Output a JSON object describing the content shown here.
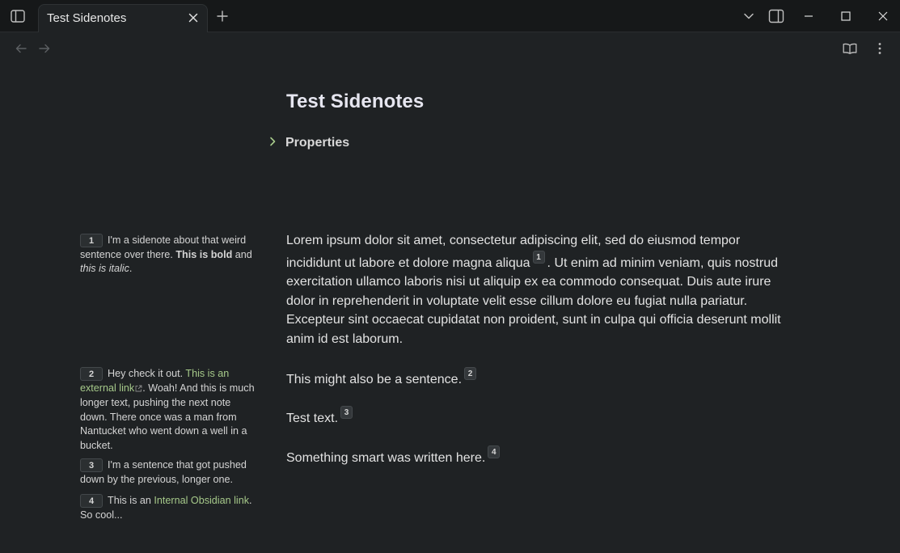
{
  "window": {
    "tab_title": "Test Sidenotes"
  },
  "note": {
    "title": "Test Sidenotes",
    "properties_label": "Properties",
    "p1_a": "Lorem ipsum dolor sit amet, consectetur adipiscing elit, sed do eiusmod tempor incididunt ut labore et dolore magna aliqua",
    "p1_ref": "1",
    "p1_b": ". Ut enim ad minim veniam, quis nostrud exercitation ullamco laboris nisi ut aliquip ex ea commodo consequat. Duis aute irure dolor in reprehenderit in voluptate velit esse cillum dolore eu fugiat nulla pariatur. Excepteur sint occaecat cupidatat non proident, sunt in culpa qui officia deserunt mollit anim id est laborum.",
    "p2": "This might also be a sentence.",
    "p2_ref": "2",
    "p3": "Test text.",
    "p3_ref": "3",
    "p4": "Something smart was written here.",
    "p4_ref": "4"
  },
  "sidenotes": {
    "s1": {
      "num": "1",
      "text_a": "I'm a sidenote about that weird sentence over there. ",
      "bold": "This is bold",
      "text_b": " and ",
      "italic": "this is italic",
      "text_c": "."
    },
    "s2": {
      "num": "2",
      "text_a": "Hey check it out. ",
      "link": "This is an external link",
      "text_b": ". Woah! And this is much longer text, pushing the next note down. There once was a man from Nantucket who went down a well in a bucket."
    },
    "s3": {
      "num": "3",
      "text": "I'm a sentence that got pushed down by the previous, longer one."
    },
    "s4": {
      "num": "4",
      "text_a": "This is an ",
      "link": "Internal Obsidian link",
      "text_b": ". So cool..."
    }
  },
  "icons": {
    "sidebar_toggle": "sidebar-left-icon",
    "close": "close-icon",
    "new_tab": "plus-icon",
    "dropdown": "chevron-down-icon",
    "right_sidebar": "sidebar-right-icon",
    "minimize": "minimize-icon",
    "maximize": "maximize-icon",
    "window_close": "window-close-icon",
    "back": "arrow-left-icon",
    "forward": "arrow-right-icon",
    "reading_view": "book-open-icon",
    "more": "more-vertical-icon",
    "properties": "chevron-right-icon",
    "external": "external-link-icon"
  },
  "colors": {
    "background": "#1f2224",
    "titlebar": "#161819",
    "link": "#a6c98a",
    "accent_chevron": "#a6c98a"
  }
}
